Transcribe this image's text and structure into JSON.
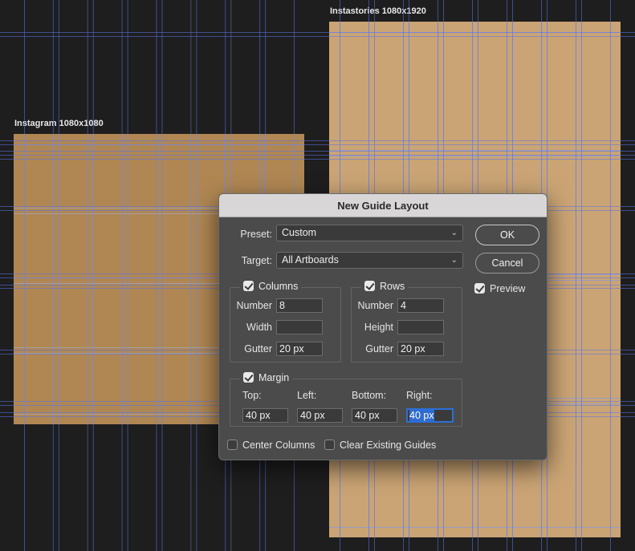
{
  "artboards": {
    "instagram": {
      "label": "Instagram 1080x1080",
      "color": "#b08753"
    },
    "instastories": {
      "label": "Instastories 1080x1920",
      "color": "#caa474"
    },
    "guide_color": "#5a74e6"
  },
  "dialog": {
    "title": "New Guide Layout",
    "preset_label": "Preset:",
    "preset_value": "Custom",
    "target_label": "Target:",
    "target_value": "All Artboards",
    "ok_label": "OK",
    "cancel_label": "Cancel",
    "preview_label": "Preview",
    "preview_checked": true,
    "columns": {
      "label": "Columns",
      "checked": true,
      "number_label": "Number",
      "number_value": "8",
      "width_label": "Width",
      "width_value": "",
      "gutter_label": "Gutter",
      "gutter_value": "20 px"
    },
    "rows": {
      "label": "Rows",
      "checked": true,
      "number_label": "Number",
      "number_value": "4",
      "height_label": "Height",
      "height_value": "",
      "gutter_label": "Gutter",
      "gutter_value": "20 px"
    },
    "margin": {
      "label": "Margin",
      "checked": true,
      "top_label": "Top:",
      "top_value": "40 px",
      "left_label": "Left:",
      "left_value": "40 px",
      "bottom_label": "Bottom:",
      "bottom_value": "40 px",
      "right_label": "Right:",
      "right_value": "40 px"
    },
    "center_columns_label": "Center Columns",
    "center_columns_checked": false,
    "clear_guides_label": "Clear Existing Guides",
    "clear_guides_checked": false
  }
}
